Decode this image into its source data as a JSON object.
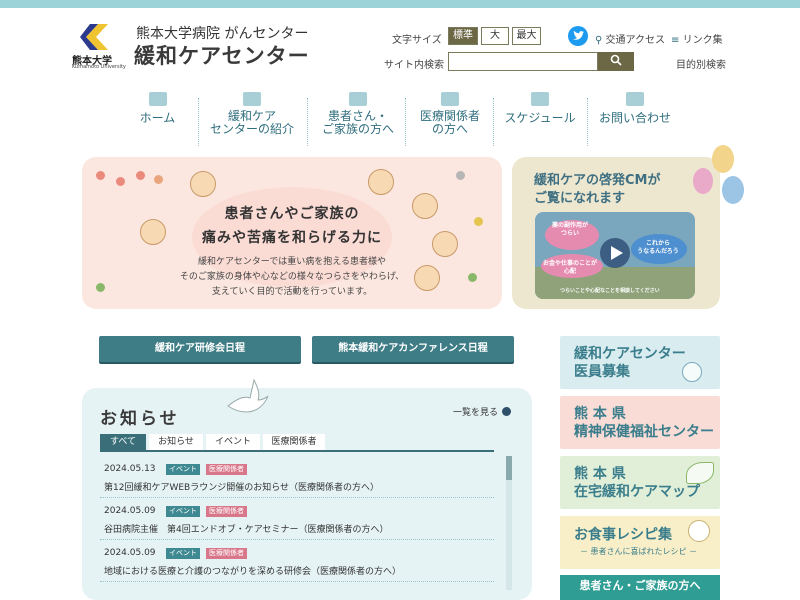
{
  "header": {
    "university": "熊本大学",
    "university_en": "Kumamoto University",
    "subtitle": "熊本大学病院 がんセンター",
    "title": "緩和ケアセンター",
    "font_size_label": "文字サイズ",
    "font_sizes": [
      "標準",
      "大",
      "最大"
    ],
    "search_label": "サイト内検索",
    "search_placeholder": "",
    "access_link": "交通アクセス",
    "links_link": "リンク集",
    "purpose_search": "目的別検索"
  },
  "nav": [
    {
      "label": "ホーム",
      "icon": "home-icon"
    },
    {
      "label": "緩和ケア\nセンターの紹介",
      "icon": "building-icon"
    },
    {
      "label": "患者さん・\nご家族の方へ",
      "icon": "bed-icon"
    },
    {
      "label": "医療関係者\nの方へ",
      "icon": "pill-icon"
    },
    {
      "label": "スケジュール",
      "icon": "calendar-icon"
    },
    {
      "label": "お問い合わせ",
      "icon": "mail-icon"
    }
  ],
  "hero": {
    "headline_1": "患者さんやご家族の",
    "headline_2": "痛みや苦痛を和らげる力に",
    "body_1": "緩和ケアセンターでは重い病を抱える患者様や",
    "body_2": "そのご家族の身体や心などの様々なつらさをやわらげ、",
    "body_3": "支えていく目的で活動を行っています。"
  },
  "cm": {
    "title_1": "緩和ケアの啓発CMが",
    "title_2": "ご覧になれます",
    "bubble_1": "薬の副作用が\nつらい",
    "bubble_2": "お金や仕事のことが\n心配",
    "bubble_3": "これから\nうなるんだろう",
    "caption": "つらいことや心配なことを相談してください"
  },
  "schedule_buttons": [
    "緩和ケア研修会日程",
    "熊本緩和ケアカンファレンス日程"
  ],
  "news": {
    "title": "お知らせ",
    "more": "一覧を見る",
    "tabs": [
      "すべて",
      "お知らせ",
      "イベント",
      "医療関係者"
    ],
    "items": [
      {
        "date": "2024.05.13",
        "tags": [
          "イベント",
          "医療関係者"
        ],
        "text": "第12回緩和ケアWEBラウンジ開催のお知らせ（医療関係者の方へ）"
      },
      {
        "date": "2024.05.09",
        "tags": [
          "イベント",
          "医療関係者"
        ],
        "text": "谷田病院主催　第4回エンドオブ・ケアセミナー（医療関係者の方へ）"
      },
      {
        "date": "2024.05.09",
        "tags": [
          "イベント",
          "医療関係者"
        ],
        "text": "地域における医療と介護のつながりを深める研修会（医療関係者の方へ）"
      }
    ]
  },
  "side_banners": [
    {
      "line1": "緩和ケアセンター",
      "line2": "医員募集",
      "bg": "#d9ecef",
      "color": "#3a7d8c"
    },
    {
      "line1": "熊 本 県",
      "line2": "精神保健福祉センター",
      "bg": "#f8dcd5",
      "color": "#3a7d8c"
    },
    {
      "line1": "熊 本 県",
      "line2": "在宅緩和ケアマップ",
      "bg": "#e1efd9",
      "color": "#3a7d8c"
    },
    {
      "line1": "お食事レシピ集",
      "line2": "－ 患者さんに喜ばれたレシピ －",
      "bg": "#f8efc8",
      "color": "#3a7d8c"
    }
  ],
  "side_bottom": "患者さん・ご家族の方へ",
  "colors": {
    "accent": "#3f7d86",
    "header_bar": "#9bd3d8",
    "nav_text": "#2f6e7e"
  }
}
